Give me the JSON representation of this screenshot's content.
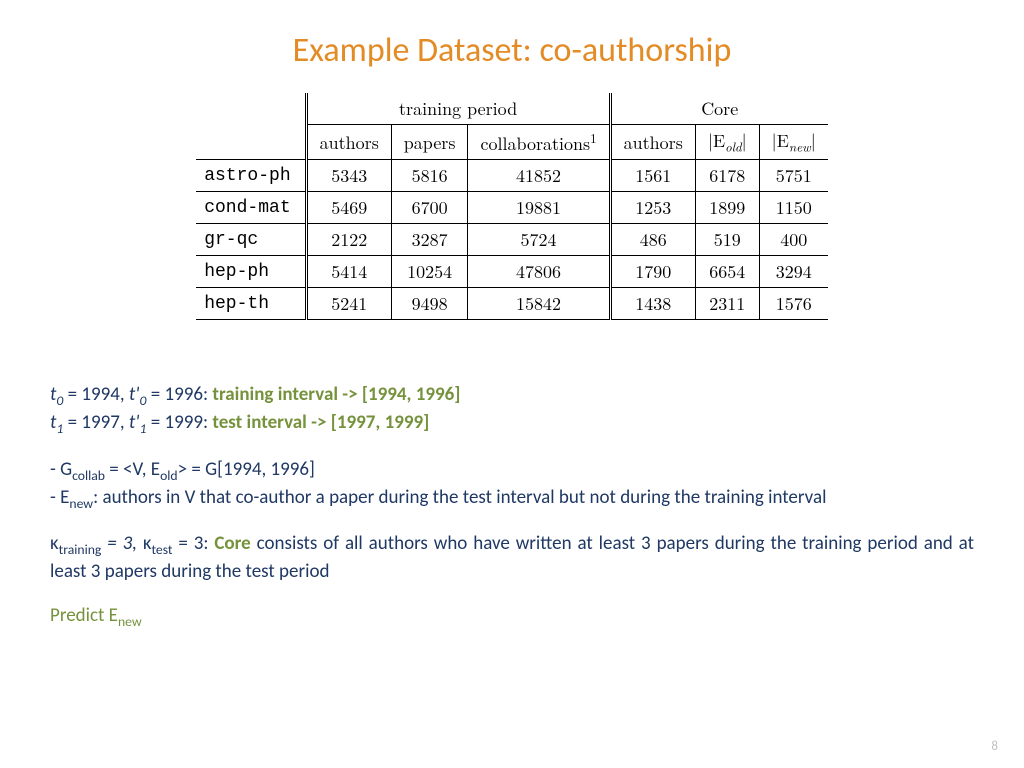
{
  "title": "Example Dataset: co-authorship",
  "table": {
    "group_headers": {
      "training": "training period",
      "core": "Core"
    },
    "col_headers": {
      "authors1": "authors",
      "papers": "papers",
      "collab": "collaborations",
      "collab_sup": "1",
      "authors2": "authors",
      "e_old": "|E",
      "e_old_sub": "old",
      "e_old_end": "|",
      "e_new": "|E",
      "e_new_sub": "new",
      "e_new_end": "|"
    },
    "rows": [
      {
        "name": "astro-ph",
        "authors": 5343,
        "papers": 5816,
        "collab": 41852,
        "c_auth": 1561,
        "e_old": 6178,
        "e_new": 5751
      },
      {
        "name": "cond-mat",
        "authors": 5469,
        "papers": 6700,
        "collab": 19881,
        "c_auth": 1253,
        "e_old": 1899,
        "e_new": 1150
      },
      {
        "name": "gr-qc",
        "authors": 2122,
        "papers": 3287,
        "collab": 5724,
        "c_auth": 486,
        "e_old": 519,
        "e_new": 400
      },
      {
        "name": "hep-ph",
        "authors": 5414,
        "papers": 10254,
        "collab": 47806,
        "c_auth": 1790,
        "e_old": 6654,
        "e_new": 3294
      },
      {
        "name": "hep-th",
        "authors": 5241,
        "papers": 9498,
        "collab": 15842,
        "c_auth": 1438,
        "e_old": 2311,
        "e_new": 1576
      }
    ]
  },
  "text": {
    "line1a": " = 1994, ",
    "line1b": " = 1996:  ",
    "line1_olive": "training interval -> [1994, 1996]",
    "line2a": " = 1997, ",
    "line2b": " = 1999: ",
    "line2_olive": "test interval -> [1997, 1999]",
    "t0": "t",
    "sub0": "0",
    "tp0": "t'",
    "t1": "t",
    "sub1": "1",
    "tp1": "t'",
    "g_line": "- G",
    "g_sub": "collab",
    "g_rest": " = <V, E",
    "g_rest_sub": "old",
    "g_rest2": "> = G[1994, 1996]",
    "e_line": "- E",
    "e_sub": "new",
    "e_rest": ": authors in V that co-author a paper during the test interval but not during the training interval",
    "k1": "κ",
    "k1_sub": "training",
    "k_mid": " = 3, ",
    "k2": "κ",
    "k2_sub": "test",
    "k_mid2": " = 3: ",
    "core": "Core",
    "k_rest": " consists of all authors who have written at least 3 papers during the training period and at least 3 papers during the test period",
    "predict": "Predict E",
    "predict_sub": "new"
  },
  "page": "8",
  "chart_data": {
    "type": "table",
    "title": "Example Dataset: co-authorship",
    "columns": [
      "dataset",
      "training_authors",
      "training_papers",
      "training_collaborations",
      "core_authors",
      "core_E_old",
      "core_E_new"
    ],
    "rows": [
      [
        "astro-ph",
        5343,
        5816,
        41852,
        1561,
        6178,
        5751
      ],
      [
        "cond-mat",
        5469,
        6700,
        19881,
        1253,
        1899,
        1150
      ],
      [
        "gr-qc",
        2122,
        3287,
        5724,
        486,
        519,
        400
      ],
      [
        "hep-ph",
        5414,
        10254,
        47806,
        1790,
        6654,
        3294
      ],
      [
        "hep-th",
        5241,
        9498,
        15842,
        1438,
        2311,
        1576
      ]
    ]
  }
}
